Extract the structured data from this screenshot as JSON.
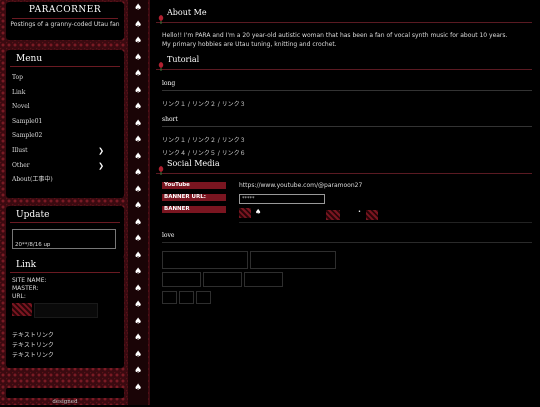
{
  "site": {
    "title": "PARACORNER",
    "subtitle": "Postings of a granny-coded Utau fan"
  },
  "menu": {
    "title": "Menu",
    "items": [
      {
        "label": "Top",
        "has_sub": false
      },
      {
        "label": "Link",
        "has_sub": false
      },
      {
        "label": "Novel",
        "has_sub": false
      },
      {
        "label": "Sample01",
        "has_sub": false
      },
      {
        "label": "Sample02",
        "has_sub": false
      },
      {
        "label": "Illust",
        "has_sub": true
      },
      {
        "label": "Other",
        "has_sub": true
      },
      {
        "label": "About(工事中)",
        "has_sub": false
      }
    ]
  },
  "update": {
    "title": "Update",
    "text": "20**/8/16 up"
  },
  "linkpanel": {
    "title": "Link",
    "site_name": "SITE NAME:",
    "master": "MASTER:",
    "url": "URL:",
    "text_links": [
      "テキストリンク",
      "テキストリンク",
      "テキストリンク"
    ]
  },
  "footer": {
    "designed": "designed"
  },
  "about": {
    "title": "About Me",
    "text": "Hello!! I'm PARA and I'm a 20 year-old autistic woman that has been a fan of vocal synth music for about 10 years. My primary hobbies are Utau tuning, knitting and crochet."
  },
  "tutorial": {
    "title": "Tutorial",
    "long_label": "long",
    "long_links": "リンク１ / リンク２ / リンク３",
    "short_label": "short",
    "short_links_1": "リンク１ / リンク２ / リンク３",
    "short_links_2": "リンク４ / リンク５ / リンク６"
  },
  "social": {
    "title": "Social Media",
    "youtube_label": "YouTube",
    "youtube_value": "https://www.youtube.com/@paramoon27",
    "banner_url_label": "BANNER URL:",
    "banner_url_value": "*****",
    "banner_label": "BANNER",
    "love_label": "love"
  },
  "colors": {
    "accent": "#7a1520",
    "background": "#000000",
    "sidebar": "#3a0a10"
  }
}
